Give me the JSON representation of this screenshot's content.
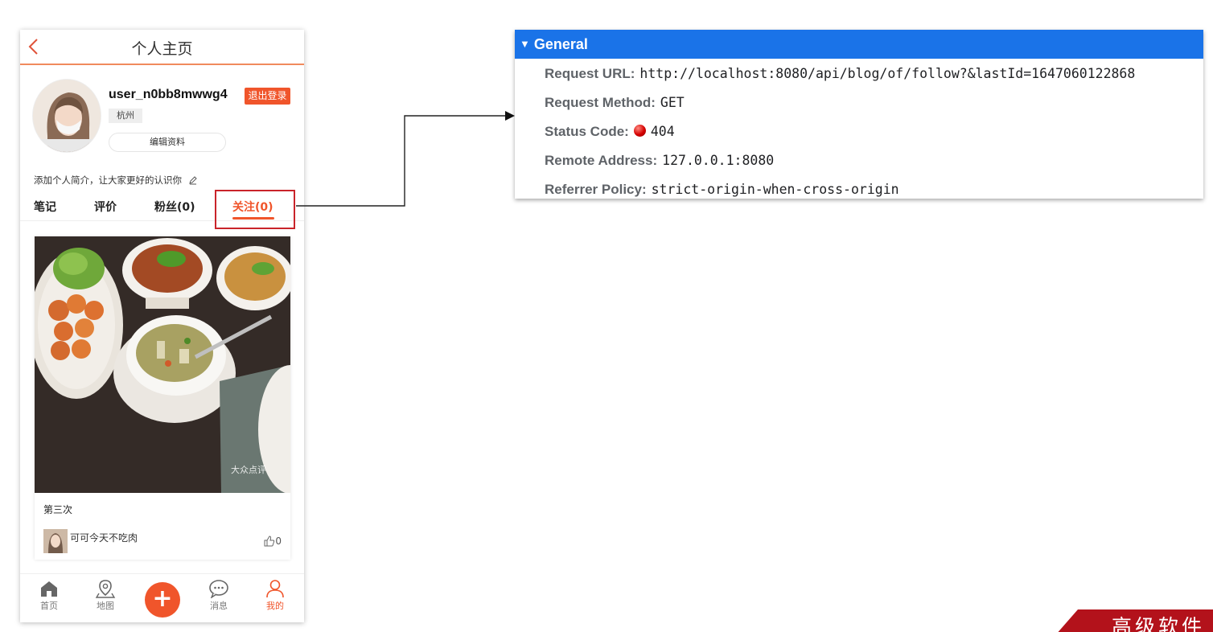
{
  "phone": {
    "header_title": "个人主页",
    "user": {
      "name": "user_n0bb8mwwg4",
      "logout_label": "退出登录",
      "city": "杭州",
      "edit_label": "编辑资料",
      "intro_placeholder": "添加个人简介，让大家更好的认识你"
    },
    "tabs": [
      {
        "label": "笔记"
      },
      {
        "label": "评价"
      },
      {
        "label": "粉丝(0)"
      },
      {
        "label": "关注(0)",
        "active": true
      }
    ],
    "card": {
      "title": "第三次",
      "author": "可可今天不吃肉",
      "likes": "0",
      "watermark": "大众点评"
    },
    "nav": [
      {
        "label": "首页",
        "icon": "home-icon"
      },
      {
        "label": "地图",
        "icon": "map-pin-icon"
      },
      {
        "label": "+",
        "icon": "plus-icon"
      },
      {
        "label": "消息",
        "icon": "message-icon"
      },
      {
        "label": "我的",
        "icon": "user-icon",
        "active": true
      }
    ]
  },
  "devtools": {
    "section_title": "General",
    "rows": [
      {
        "key": "Request URL:",
        "value": "http://localhost:8080/api/blog/of/follow?&lastId=1647060122868"
      },
      {
        "key": "Request Method:",
        "value": "GET"
      },
      {
        "key": "Status Code:",
        "value": "404"
      },
      {
        "key": "Remote Address:",
        "value": "127.0.0.1:8080"
      },
      {
        "key": "Referrer Policy:",
        "value": "strict-origin-when-cross-origin"
      }
    ]
  },
  "banner": {
    "text": "高级软件"
  },
  "colors": {
    "accent": "#f0552b",
    "panel_header": "#1a73e8",
    "highlight": "#c9242a",
    "banner": "#b3121b"
  }
}
